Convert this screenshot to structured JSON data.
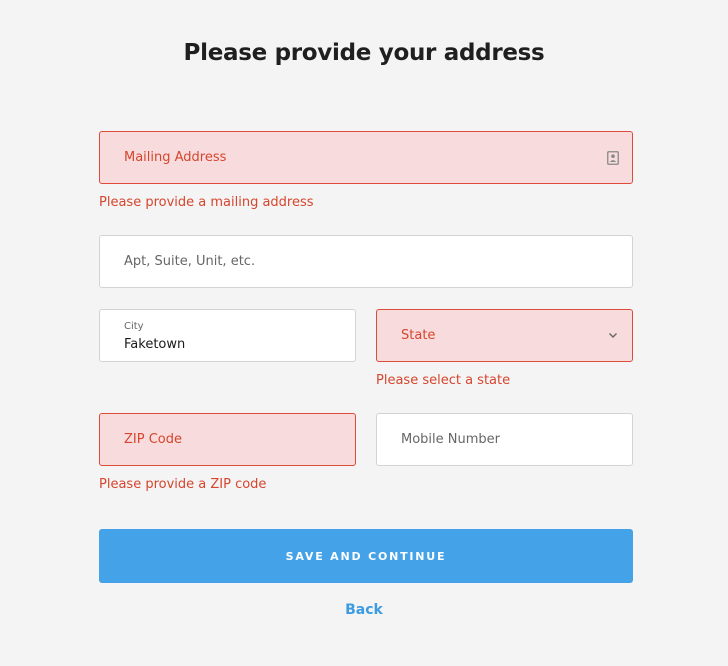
{
  "page": {
    "title": "Please provide your address"
  },
  "form": {
    "mailing_address": {
      "placeholder": "Mailing Address",
      "value": "",
      "error": "Please provide a mailing address",
      "icon": "contact-card-icon"
    },
    "apt": {
      "placeholder": "Apt, Suite, Unit, etc.",
      "value": ""
    },
    "city": {
      "label": "City",
      "value": "Faketown"
    },
    "state": {
      "placeholder": "State",
      "error": "Please select a state",
      "icon": "chevron-down-icon"
    },
    "zip": {
      "placeholder": "ZIP Code",
      "value": "",
      "error": "Please provide a ZIP code"
    },
    "mobile": {
      "placeholder": "Mobile Number",
      "value": ""
    }
  },
  "actions": {
    "save_label": "SAVE AND CONTINUE",
    "back_label": "Back"
  },
  "colors": {
    "background": "#f4f4f4",
    "error_text": "#d6452e",
    "error_border": "#dd4b39",
    "error_fill": "#f8dcdd",
    "primary_button": "#44a3e8",
    "link": "#3d9be0"
  }
}
